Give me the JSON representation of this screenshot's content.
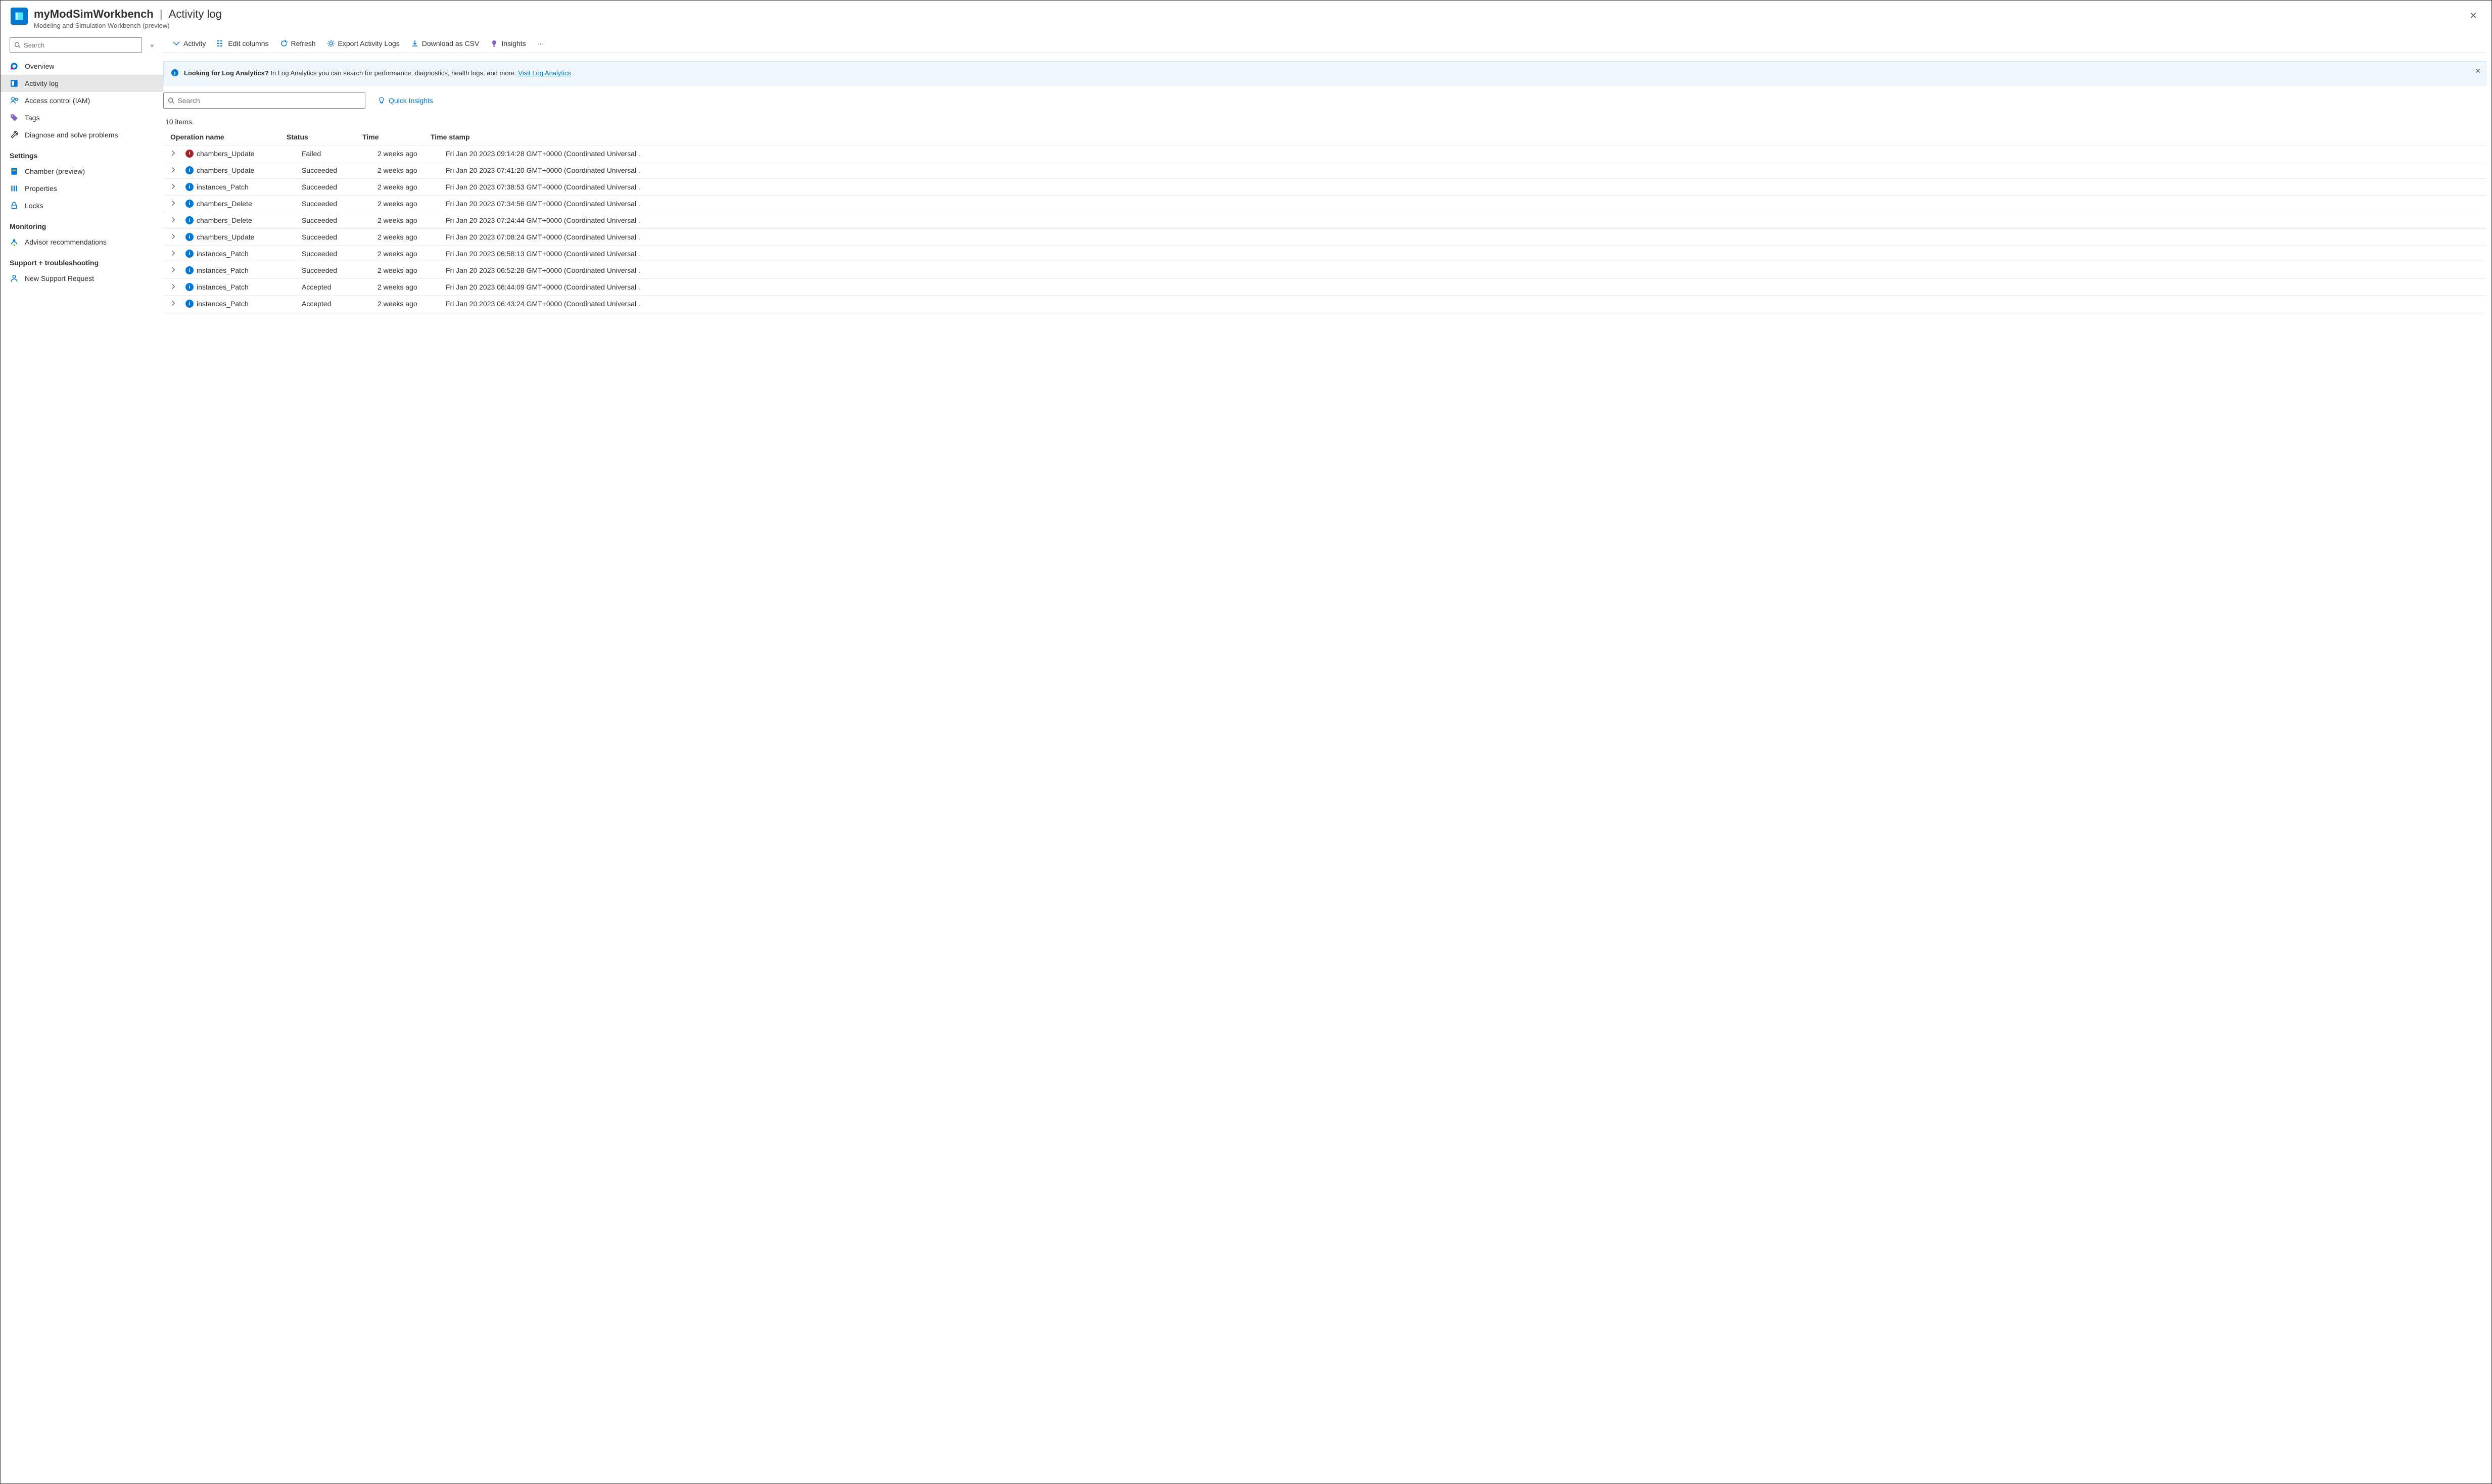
{
  "header": {
    "resource_name": "myModSimWorkbench",
    "blade_title": "Activity log",
    "subtitle": "Modeling and Simulation Workbench (preview)"
  },
  "sidebar": {
    "search_placeholder": "Search",
    "items_top": [
      {
        "label": "Overview",
        "icon": "overview"
      },
      {
        "label": "Activity log",
        "icon": "activitylog",
        "selected": true
      },
      {
        "label": "Access control (IAM)",
        "icon": "iam"
      },
      {
        "label": "Tags",
        "icon": "tags"
      },
      {
        "label": "Diagnose and solve problems",
        "icon": "diagnose"
      }
    ],
    "group_settings": "Settings",
    "items_settings": [
      {
        "label": "Chamber (preview)",
        "icon": "chamber"
      },
      {
        "label": "Properties",
        "icon": "properties"
      },
      {
        "label": "Locks",
        "icon": "locks"
      }
    ],
    "group_monitoring": "Monitoring",
    "items_monitoring": [
      {
        "label": "Advisor recommendations",
        "icon": "advisor"
      }
    ],
    "group_support": "Support + troubleshooting",
    "items_support": [
      {
        "label": "New Support Request",
        "icon": "support"
      }
    ]
  },
  "toolbar": {
    "activity": "Activity",
    "edit_columns": "Edit columns",
    "refresh": "Refresh",
    "export": "Export Activity Logs",
    "download": "Download as CSV",
    "insights": "Insights"
  },
  "banner": {
    "bold": "Looking for Log Analytics?",
    "text": "In Log Analytics you can search for performance, diagnostics, health logs, and more.",
    "link": "Visit Log Analytics"
  },
  "main_search_placeholder": "Search",
  "quick_insights": "Quick Insights",
  "items_count": "10 items.",
  "columns": {
    "op": "Operation name",
    "status": "Status",
    "time": "Time",
    "ts": "Time stamp"
  },
  "rows": [
    {
      "op": "chambers_Update",
      "status": "Failed",
      "st": "err",
      "time": "2 weeks ago",
      "ts": "Fri Jan 20 2023 09:14:28 GMT+0000 (Coordinated Universal ."
    },
    {
      "op": "chambers_Update",
      "status": "Succeeded",
      "st": "info",
      "time": "2 weeks ago",
      "ts": "Fri Jan 20 2023 07:41:20 GMT+0000 (Coordinated Universal ."
    },
    {
      "op": "instances_Patch",
      "status": "Succeeded",
      "st": "info",
      "time": "2 weeks ago",
      "ts": "Fri Jan 20 2023 07:38:53 GMT+0000 (Coordinated Universal ."
    },
    {
      "op": "chambers_Delete",
      "status": "Succeeded",
      "st": "info",
      "time": "2 weeks ago",
      "ts": "Fri Jan 20 2023 07:34:56 GMT+0000 (Coordinated Universal ."
    },
    {
      "op": "chambers_Delete",
      "status": "Succeeded",
      "st": "info",
      "time": "2 weeks ago",
      "ts": "Fri Jan 20 2023 07:24:44 GMT+0000 (Coordinated Universal ."
    },
    {
      "op": "chambers_Update",
      "status": "Succeeded",
      "st": "info",
      "time": "2 weeks ago",
      "ts": "Fri Jan 20 2023 07:08:24 GMT+0000 (Coordinated Universal ."
    },
    {
      "op": "instances_Patch",
      "status": "Succeeded",
      "st": "info",
      "time": "2 weeks ago",
      "ts": "Fri Jan 20 2023 06:58:13 GMT+0000 (Coordinated Universal ."
    },
    {
      "op": "instances_Patch",
      "status": "Succeeded",
      "st": "info",
      "time": "2 weeks ago",
      "ts": "Fri Jan 20 2023 06:52:28 GMT+0000 (Coordinated Universal ."
    },
    {
      "op": "instances_Patch",
      "status": "Accepted",
      "st": "info",
      "time": "2 weeks ago",
      "ts": "Fri Jan 20 2023 06:44:09 GMT+0000 (Coordinated Universal ."
    },
    {
      "op": "instances_Patch",
      "status": "Accepted",
      "st": "info",
      "time": "2 weeks ago",
      "ts": "Fri Jan 20 2023 06:43:24 GMT+0000 (Coordinated Universal ."
    }
  ]
}
